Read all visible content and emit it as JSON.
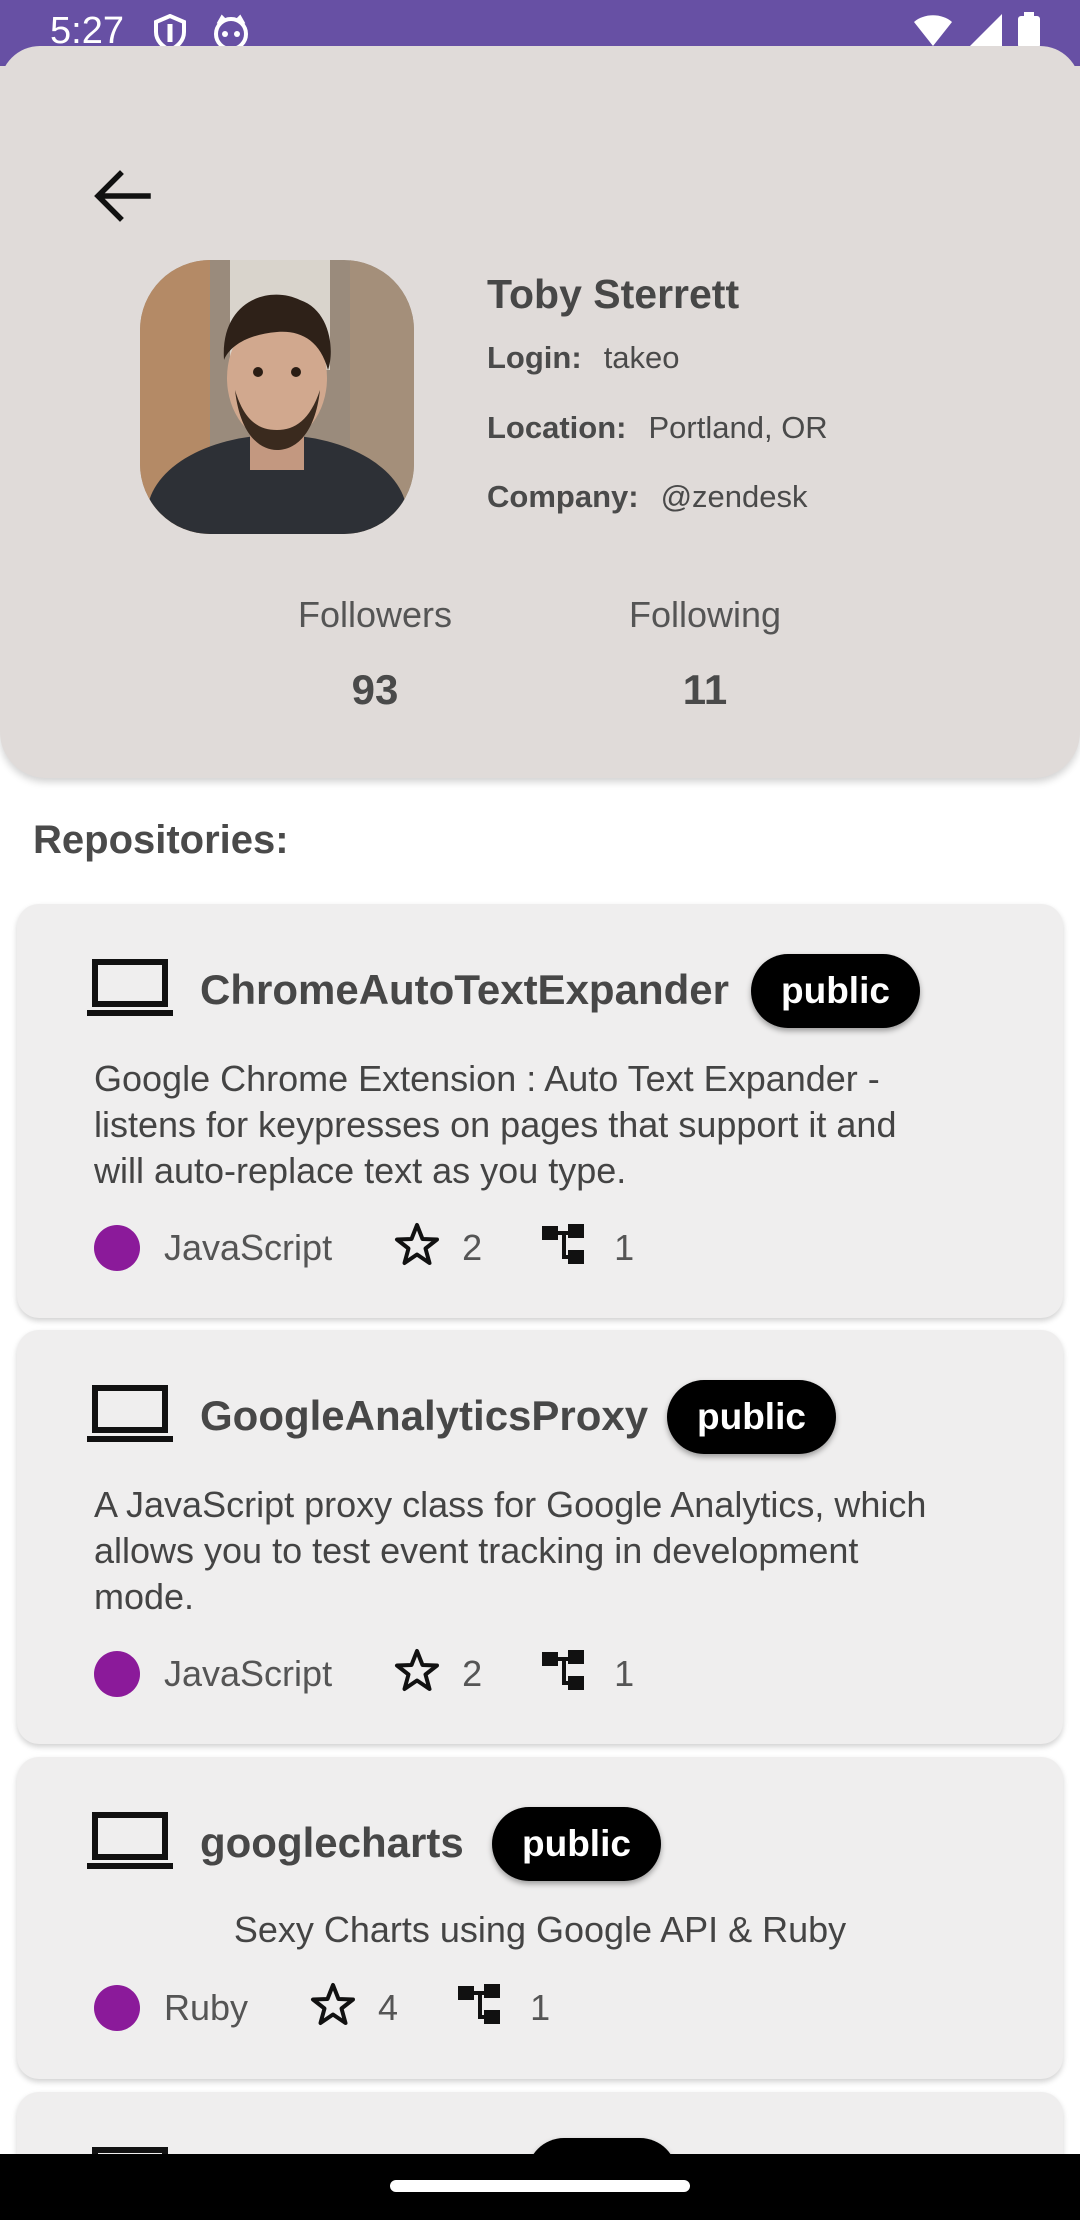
{
  "status_bar": {
    "time": "5:27",
    "icons": [
      "shield-icon",
      "cat-icon",
      "wifi-icon",
      "signal-icon",
      "battery-icon"
    ],
    "background": "#6750a4"
  },
  "profile": {
    "name": "Toby Sterrett",
    "login_label": "Login:",
    "login": "takeo",
    "location_label": "Location:",
    "location": "Portland, OR",
    "company_label": "Company:",
    "company": "@zendesk",
    "followers_label": "Followers",
    "followers": "93",
    "following_label": "Following",
    "following": "11"
  },
  "repositories_title": "Repositories:",
  "repos": [
    {
      "name": "ChromeAutoTextExpander",
      "visibility": "public",
      "description": "Google Chrome Extension : Auto Text Expander - listens for keypresses on pages that support it and will auto-replace text as you type.",
      "language": "JavaScript",
      "stars": "2",
      "forks": "1"
    },
    {
      "name": "GoogleAnalyticsProxy",
      "visibility": "public",
      "description": "A JavaScript proxy class for Google Analytics, which allows you to test event tracking in development mode.",
      "language": "JavaScript",
      "stars": "2",
      "forks": "1"
    },
    {
      "name": "googlecharts",
      "visibility": "public",
      "description": "Sexy Charts using Google API & Ruby",
      "language": "Ruby",
      "stars": "4",
      "forks": "1"
    }
  ],
  "colors": {
    "header_bg": "#e0dbd9",
    "card_bg": "#efeeee",
    "language_dot": "#8b1a9a",
    "badge_bg": "#000000"
  }
}
